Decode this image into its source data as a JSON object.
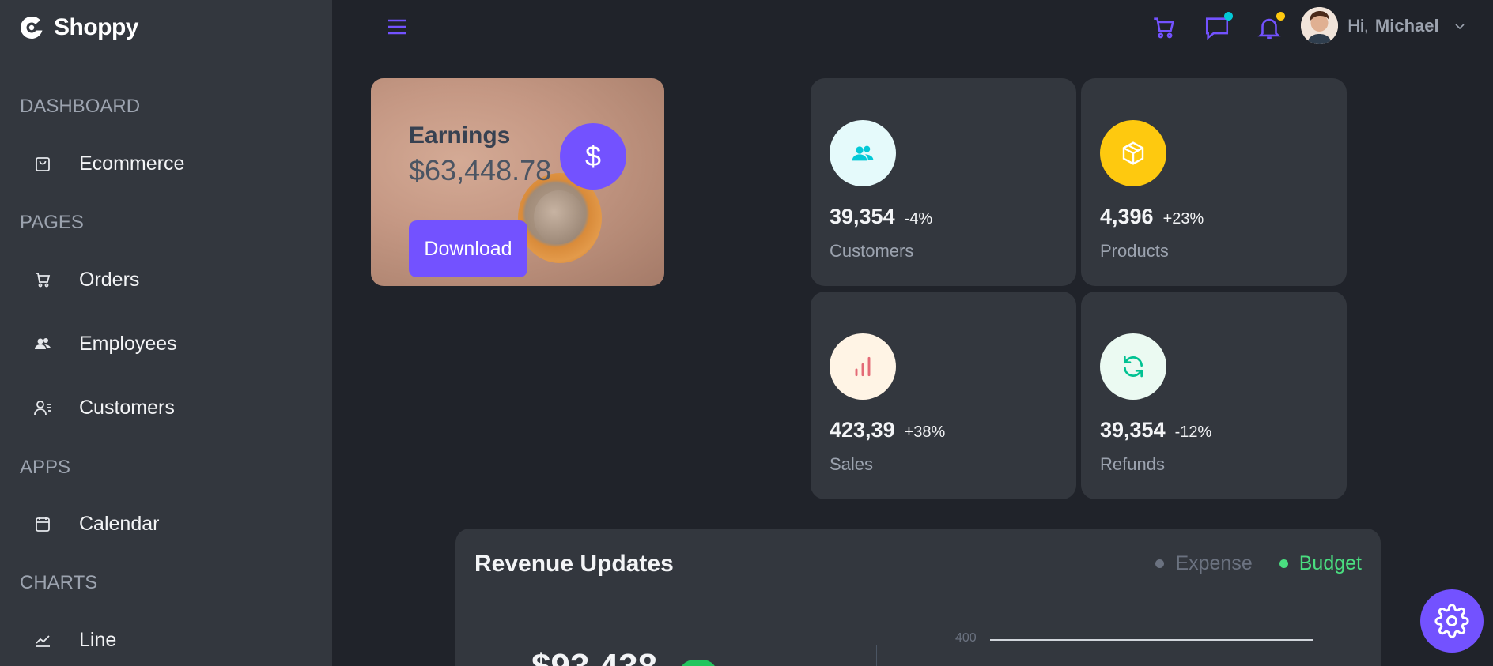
{
  "brand": {
    "name": "Shoppy"
  },
  "sidebar": {
    "sections": [
      {
        "title": "DASHBOARD",
        "items": [
          {
            "label": "Ecommerce",
            "icon": "shopping-bag-icon"
          }
        ]
      },
      {
        "title": "PAGES",
        "items": [
          {
            "label": "Orders",
            "icon": "cart-icon"
          },
          {
            "label": "Employees",
            "icon": "users-icon"
          },
          {
            "label": "Customers",
            "icon": "user-list-icon"
          }
        ]
      },
      {
        "title": "APPS",
        "items": [
          {
            "label": "Calendar",
            "icon": "calendar-icon"
          }
        ]
      },
      {
        "title": "CHARTS",
        "items": [
          {
            "label": "Line",
            "icon": "line-chart-icon"
          }
        ]
      }
    ]
  },
  "header": {
    "greeting": "Hi,",
    "user_name": "Michael"
  },
  "earnings": {
    "title": "Earnings",
    "value": "$63,448.78",
    "currency_symbol": "$",
    "download_label": "Download"
  },
  "stats": [
    {
      "value": "39,354",
      "percent": "-4%",
      "label": "Customers",
      "icon": "users-icon",
      "icon_color": "#03c9d7",
      "icon_bg": "#e5fafb"
    },
    {
      "value": "4,396",
      "percent": "+23%",
      "label": "Products",
      "icon": "box-icon",
      "icon_color": "#ffffff",
      "icon_bg": "#fec90f"
    },
    {
      "value": "423,39",
      "percent": "+38%",
      "label": "Sales",
      "icon": "bar-chart-icon",
      "icon_color": "#e46a76",
      "icon_bg": "#fff4e5"
    },
    {
      "value": "39,354",
      "percent": "-12%",
      "label": "Refunds",
      "icon": "refresh-icon",
      "icon_color": "#00c292",
      "icon_bg": "#ebfaf2"
    }
  ],
  "revenue": {
    "title": "Revenue Updates",
    "legend": [
      {
        "label": "Expense",
        "color": "#6b7280"
      },
      {
        "label": "Budget",
        "color": "#4ade80"
      }
    ],
    "amount": "$93,438",
    "axis_tick": "400"
  },
  "colors": {
    "accent": "#7352ff",
    "sidebar_bg": "#33373e",
    "page_bg": "#20232a",
    "card_bg": "#33373e"
  }
}
